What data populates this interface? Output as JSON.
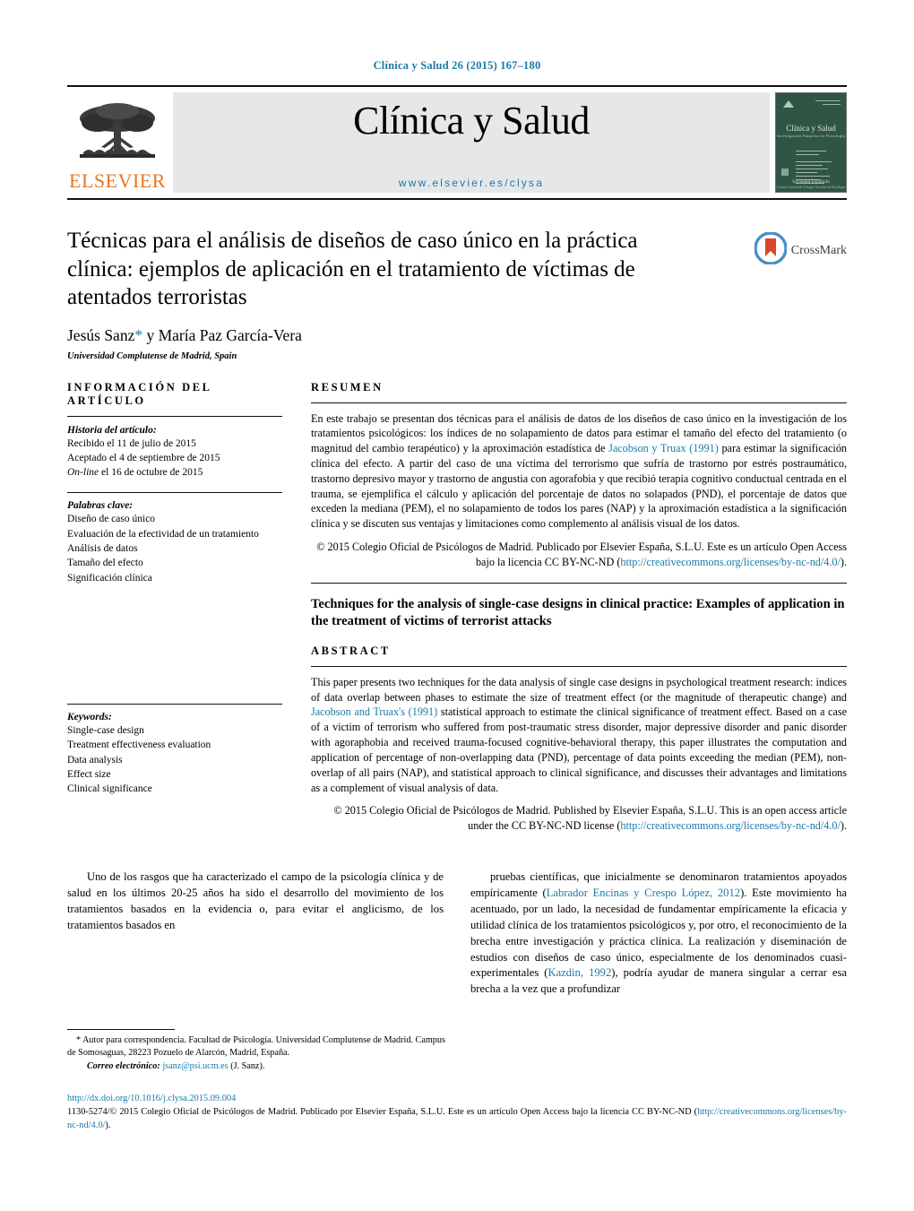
{
  "running_head": "Clínica y Salud 26 (2015) 167–180",
  "masthead": {
    "publisher_name": "ELSEVIER",
    "journal_title": "Clínica y Salud",
    "journal_url": "www.elsevier.es/clysa",
    "cover": {
      "title": "Clínica y Salud",
      "subtitle": "Investigación Empírica en Psicología",
      "footer": "Sociedad Española",
      "footer_sub": "Consejo General de Colegios Oficiales de Psicólogos"
    }
  },
  "article": {
    "title": "Técnicas para el análisis de diseños de caso único en la práctica clínica: ejemplos de aplicación en el tratamiento de víctimas de atentados terroristas",
    "authors": "Jesús Sanz",
    "authors_rest": " y María Paz García-Vera",
    "corresponding_marker": "*",
    "affiliation": "Universidad Complutense de Madrid, Spain",
    "crossmark_label": "CrossMark"
  },
  "info_panel": {
    "heading": "información del artículo",
    "history_label": "Historia del artículo:",
    "history": [
      "Recibido el 11 de julio de 2015",
      "Aceptado el 4 de septiembre de 2015"
    ],
    "online_italic": "On-line",
    "online_rest": " el 16 de octubre de 2015",
    "keywords_es_label": "Palabras clave:",
    "keywords_es": [
      "Diseño de caso único",
      "Evaluación de la efectividad de un tratamiento",
      "Análisis de datos",
      "Tamaño del efecto",
      "Significación clínica"
    ],
    "keywords_en_label": "Keywords:",
    "keywords_en": [
      "Single-case design",
      "Treatment effectiveness evaluation",
      "Data analysis",
      "Effect size",
      "Clinical significance"
    ]
  },
  "resumen": {
    "heading": "resumen",
    "part1": "En este trabajo se presentan dos técnicas para el análisis de datos de los diseños de caso único en la investigación de los tratamientos psicológicos: los índices de no solapamiento de datos para estimar el tamaño del efecto del tratamiento (o magnitud del cambio terapéutico) y la aproximación estadística de ",
    "citation": "Jacobson y Truax (1991)",
    "part2": " para estimar la significación clínica del efecto. A partir del caso de una víctima del terrorismo que sufría de trastorno por estrés postraumático, trastorno depresivo mayor y trastorno de angustia con agorafobia y que recibió terapia cognitivo conductual centrada en el trauma, se ejemplifica el cálculo y aplicación del porcentaje de datos no solapados (PND), el porcentaje de datos que exceden la mediana (PEM), el no solapamiento de todos los pares (NAP) y la aproximación estadística a la significación clínica y se discuten sus ventajas y limitaciones como complemento al análisis visual de los datos.",
    "copyright": "© 2015 Colegio Oficial de Psicólogos de Madrid. Publicado por Elsevier España, S.L.U. Este es un artículo Open Access bajo la licencia CC BY-NC-ND (",
    "license_url": "http://creativecommons.org/licenses/by-nc-nd/4.0/",
    "copyright_end": ")."
  },
  "abstract": {
    "en_title": "Techniques for the analysis of single-case designs in clinical practice: Examples of application in the treatment of victims of terrorist attacks",
    "heading": "abstract",
    "part1": "This paper presents two techniques for the data analysis of single case designs in psychological treatment research: indices of data overlap between phases to estimate the size of treatment effect (or the magnitude of therapeutic change) and ",
    "citation": "Jacobson and Truax's (1991)",
    "part2": " statistical approach to estimate the clinical significance of treatment effect. Based on a case of a victim of terrorism who suffered from post-traumatic stress disorder, major depressive disorder and panic disorder with agoraphobia and received trauma-focused cognitive-behavioral therapy, this paper illustrates the computation and application of percentage of non-overlapping data (PND), percentage of data points exceeding the median (PEM), non-overlap of all pairs (NAP), and statistical approach to clinical significance, and discusses their advantages and limitations as a complement of visual analysis of data.",
    "copyright": "© 2015 Colegio Oficial de Psicólogos de Madrid. Published by Elsevier España, S.L.U. This is an open access article under the CC BY-NC-ND license (",
    "license_url": "http://creativecommons.org/licenses/by-nc-nd/4.0/",
    "copyright_end": ")."
  },
  "body": {
    "left_column": "Uno de los rasgos que ha caracterizado el campo de la psicología clínica y de salud en los últimos 20-25 años ha sido el desarrollo del movimiento de los tratamientos basados en la evidencia o, para evitar el anglicismo, de los tratamientos basados en",
    "right_part1": "pruebas científicas, que inicialmente se denominaron tratamientos apoyados empíricamente (",
    "right_citation1": "Labrador Encinas y Crespo López, 2012",
    "right_part2": "). Este movimiento ha acentuado, por un lado, la necesidad de fundamentar empíricamente la eficacia y utilidad clínica de los tratamientos psicológicos y, por otro, el reconocimiento de la brecha entre investigación y práctica clínica. La realización y diseminación de estudios con diseños de caso único, especialmente de los denominados cuasi-experimentales (",
    "right_citation2": "Kazdin, 1992",
    "right_part3": "), podría ayudar de manera singular a cerrar esa brecha a la vez que a profundizar"
  },
  "footnote": {
    "marker": "*",
    "text": " Autor para correspondencia. Facultad de Psicología. Universidad Complutense de Madrid. Campus de Somosaguas, 28223 Pozuelo de Alarcón, Madrid, España.",
    "email_label": "Correo electrónico:",
    "email": "jsanz@psi.ucm.es",
    "email_suffix": " (J. Sanz)."
  },
  "page_footer": {
    "doi": "http://dx.doi.org/10.1016/j.clysa.2015.09.004",
    "issn_line": "1130-5274/© 2015 Colegio Oficial de Psicólogos de Madrid. Publicado por Elsevier España, S.L.U. Este es un artículo Open Access bajo la licencia CC BY-NC-ND (",
    "license_url": "http://creativecommons.org/licenses/by-nc-nd/4.0/",
    "issn_end": ")."
  },
  "colors": {
    "link_blue": "#1a7aa8",
    "elsevier_orange": "#E87722",
    "masthead_band": "#e6e7e8",
    "cover_green": "#2f5545",
    "crossmark_blue": "#4a90c4",
    "crossmark_red": "#d9462b"
  }
}
